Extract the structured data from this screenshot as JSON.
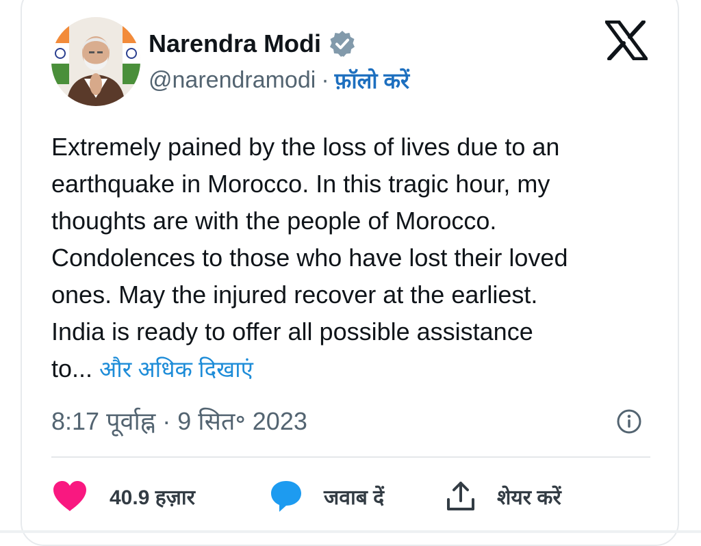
{
  "author": {
    "name": "Narendra Modi",
    "handle": "@narendramodi",
    "separator": "·",
    "follow_label": "फ़ॉलो करें"
  },
  "icons": {
    "brand": "x-logo-icon",
    "verified": "verified-badge-icon",
    "info": "info-icon",
    "like": "heart-icon",
    "reply": "reply-bubble-icon",
    "share": "share-icon"
  },
  "colors": {
    "text": "#0f1419",
    "muted": "#536471",
    "link": "#1d8cd8",
    "like": "#f91880",
    "reply": "#1d9bf0"
  },
  "tweet": {
    "lines": [
      "Extremely pained by the loss of lives due to an",
      "earthquake in Morocco. In this tragic hour, my",
      "thoughts are with the people of Morocco.",
      "Condolences to those who have lost their loved",
      "ones. May the injured recover at the earliest.",
      "India is ready to offer all possible assistance"
    ],
    "last_line": "to...",
    "show_more": "और अधिक दिखाएं",
    "timestamp": "8:17 पूर्वाह्न · 9 सित॰ 2023"
  },
  "actions": {
    "likes": "40.9 हज़ार",
    "reply": "जवाब दें",
    "share": "शेयर करें"
  }
}
